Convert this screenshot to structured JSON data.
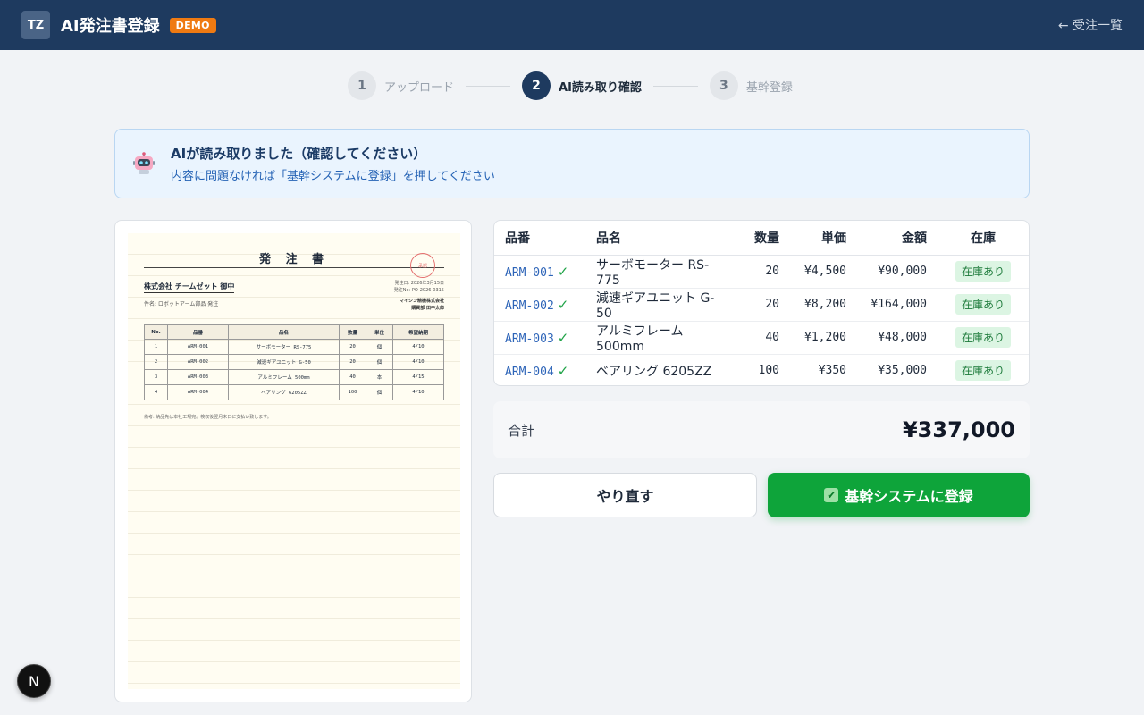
{
  "header": {
    "logo_text": "TZ",
    "title": "AI発注書登録",
    "badge": "DEMO",
    "back_link": "← 受注一覧"
  },
  "stepper": {
    "steps": [
      {
        "num": "1",
        "label": "アップロード",
        "active": false
      },
      {
        "num": "2",
        "label": "AI読み取り確認",
        "active": true
      },
      {
        "num": "3",
        "label": "基幹登録",
        "active": false
      }
    ]
  },
  "notice": {
    "icon": "robot-icon",
    "title": "AIが読み取りました（確認してください）",
    "subtitle": "内容に問題なければ「基幹システムに登録」を押してください"
  },
  "document": {
    "title": "発 注 書",
    "seal_text": "承認",
    "to_company": "株式会社 チームゼット 御中",
    "meta": [
      "発注日: 2026年3月15日",
      "発注No: PO-2026-0315"
    ],
    "subject": "件名: ロボットアーム部品 発注",
    "sender": [
      "マイシン精機株式会社",
      "購買部 田中太郎"
    ],
    "columns": [
      "No.",
      "品番",
      "品名",
      "数量",
      "単位",
      "希望納期"
    ],
    "rows": [
      [
        "1",
        "ARM-001",
        "サーボモーター RS-775",
        "20",
        "個",
        "4/10"
      ],
      [
        "2",
        "ARM-002",
        "減速ギアユニット G-50",
        "20",
        "個",
        "4/10"
      ],
      [
        "3",
        "ARM-003",
        "アルミフレーム 500mm",
        "40",
        "本",
        "4/15"
      ],
      [
        "4",
        "ARM-004",
        "ベアリング 6205ZZ",
        "100",
        "個",
        "4/10"
      ]
    ],
    "note": "備考: 納品先は本社工場宛。検収後翌月末日に支払い致します。"
  },
  "items_table": {
    "columns": [
      "品番",
      "品名",
      "数量",
      "単価",
      "金額",
      "在庫"
    ],
    "rows": [
      {
        "code": "ARM-001",
        "check": "✓",
        "name": "サーボモーター RS-775",
        "qty": "20",
        "unit_price": "¥4,500",
        "amount": "¥90,000",
        "stock": "在庫あり"
      },
      {
        "code": "ARM-002",
        "check": "✓",
        "name": "減速ギアユニット G-50",
        "qty": "20",
        "unit_price": "¥8,200",
        "amount": "¥164,000",
        "stock": "在庫あり"
      },
      {
        "code": "ARM-003",
        "check": "✓",
        "name": "アルミフレーム 500mm",
        "qty": "40",
        "unit_price": "¥1,200",
        "amount": "¥48,000",
        "stock": "在庫あり"
      },
      {
        "code": "ARM-004",
        "check": "✓",
        "name": "ベアリング 6205ZZ",
        "qty": "100",
        "unit_price": "¥350",
        "amount": "¥35,000",
        "stock": "在庫あり"
      }
    ]
  },
  "total": {
    "label": "合計",
    "value": "¥337,000"
  },
  "actions": {
    "retry_label": "やり直す",
    "register_label": "基幹システムに登録",
    "register_icon": "checkbox-icon"
  },
  "fab": {
    "label": "N"
  },
  "colors": {
    "header_bg": "#1e3a5f",
    "accent_green": "#0ea43a",
    "demo_badge": "#ef7a12",
    "link_blue": "#2d64b8"
  }
}
